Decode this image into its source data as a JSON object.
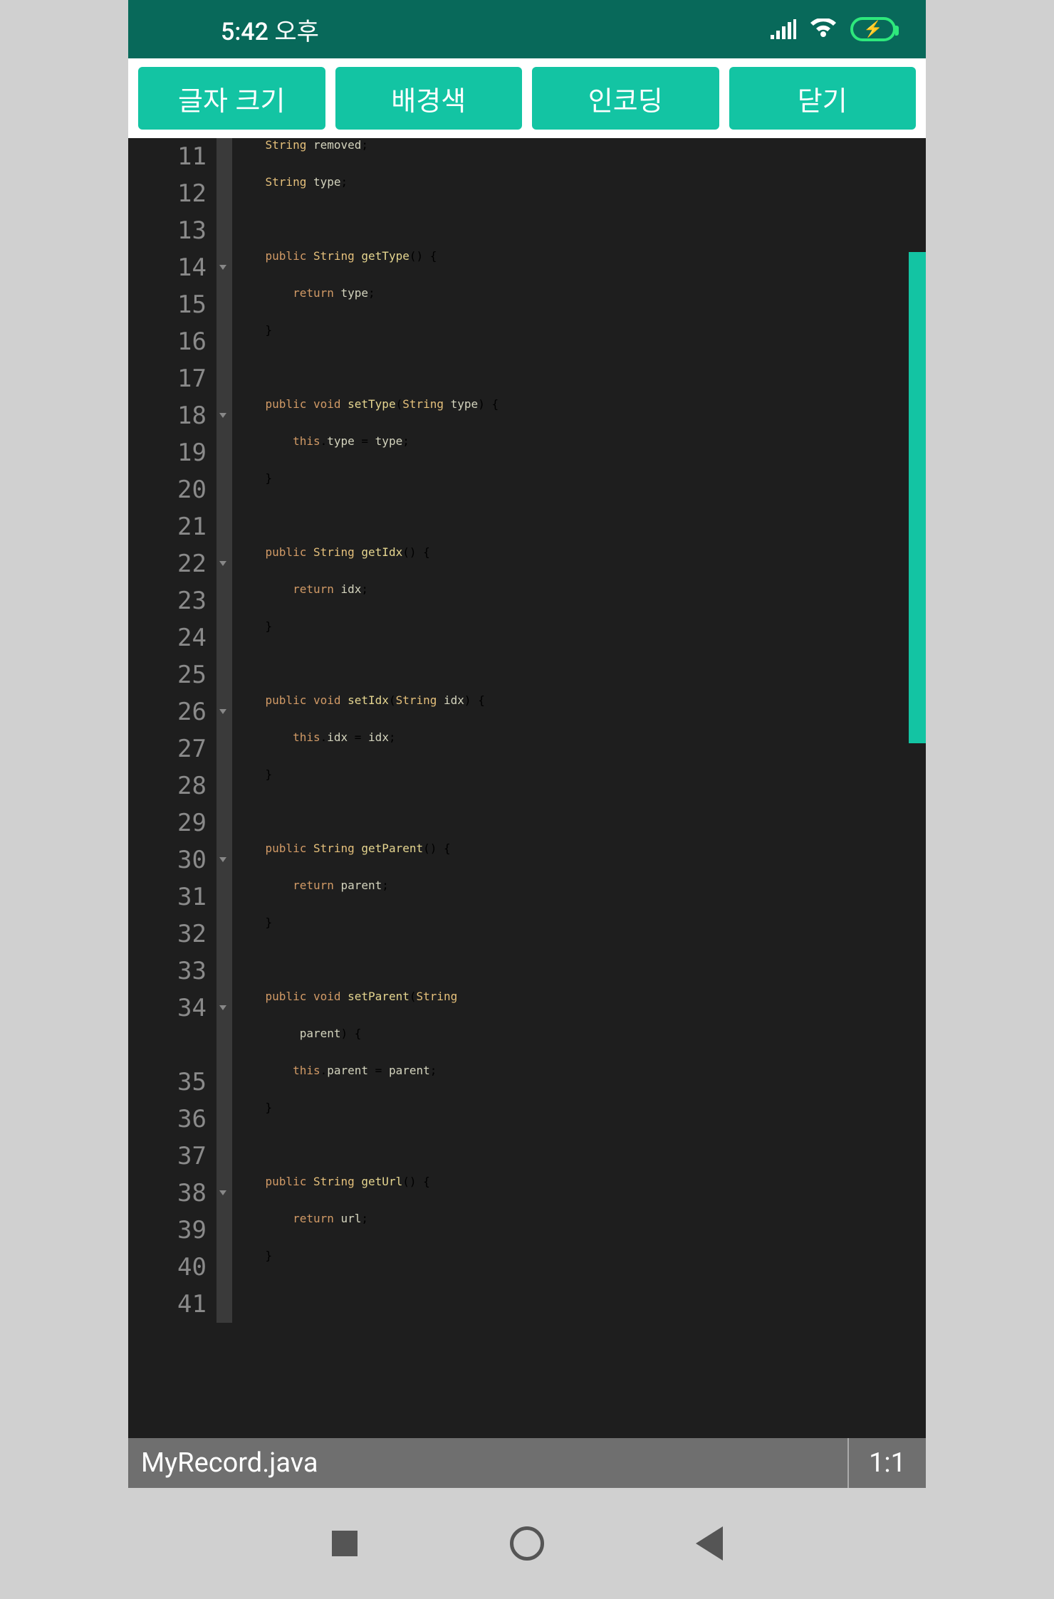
{
  "status": {
    "time": "5:42 오후"
  },
  "toolbar": {
    "font_size": "글자 크기",
    "bg_color": "배경색",
    "encoding": "인코딩",
    "close": "닫기"
  },
  "lines": [
    {
      "n": "11",
      "fold": false,
      "segs": [
        {
          "t": "    "
        },
        {
          "t": "String",
          "c": "ty"
        },
        {
          "t": " "
        },
        {
          "t": "removed",
          "c": "id"
        },
        {
          "t": ";"
        }
      ]
    },
    {
      "n": "12",
      "fold": false,
      "segs": [
        {
          "t": "    "
        },
        {
          "t": "String",
          "c": "ty"
        },
        {
          "t": " "
        },
        {
          "t": "type",
          "c": "id"
        },
        {
          "t": ";"
        }
      ]
    },
    {
      "n": "13",
      "fold": false,
      "segs": [
        {
          "t": ""
        }
      ]
    },
    {
      "n": "14",
      "fold": true,
      "segs": [
        {
          "t": "    "
        },
        {
          "t": "public",
          "c": "kw"
        },
        {
          "t": " "
        },
        {
          "t": "String",
          "c": "ty"
        },
        {
          "t": " "
        },
        {
          "t": "getType",
          "c": "fn"
        },
        {
          "t": "() {"
        }
      ]
    },
    {
      "n": "15",
      "fold": false,
      "segs": [
        {
          "t": "        "
        },
        {
          "t": "return",
          "c": "kw"
        },
        {
          "t": " "
        },
        {
          "t": "type",
          "c": "id"
        },
        {
          "t": ";"
        }
      ]
    },
    {
      "n": "16",
      "fold": false,
      "segs": [
        {
          "t": "    }"
        }
      ]
    },
    {
      "n": "17",
      "fold": false,
      "segs": [
        {
          "t": ""
        }
      ]
    },
    {
      "n": "18",
      "fold": true,
      "segs": [
        {
          "t": "    "
        },
        {
          "t": "public",
          "c": "kw"
        },
        {
          "t": " "
        },
        {
          "t": "void",
          "c": "kw"
        },
        {
          "t": " "
        },
        {
          "t": "setType",
          "c": "fn"
        },
        {
          "t": "("
        },
        {
          "t": "String",
          "c": "ty"
        },
        {
          "t": " "
        },
        {
          "t": "type",
          "c": "id"
        },
        {
          "t": ") {"
        }
      ]
    },
    {
      "n": "19",
      "fold": false,
      "segs": [
        {
          "t": "        "
        },
        {
          "t": "this",
          "c": "th"
        },
        {
          "t": "."
        },
        {
          "t": "type",
          "c": "id"
        },
        {
          "t": " = "
        },
        {
          "t": "type",
          "c": "id"
        },
        {
          "t": ";"
        }
      ]
    },
    {
      "n": "20",
      "fold": false,
      "segs": [
        {
          "t": "    }"
        }
      ]
    },
    {
      "n": "21",
      "fold": false,
      "segs": [
        {
          "t": ""
        }
      ]
    },
    {
      "n": "22",
      "fold": true,
      "segs": [
        {
          "t": "    "
        },
        {
          "t": "public",
          "c": "kw"
        },
        {
          "t": " "
        },
        {
          "t": "String",
          "c": "ty"
        },
        {
          "t": " "
        },
        {
          "t": "getIdx",
          "c": "fn"
        },
        {
          "t": "() {"
        }
      ]
    },
    {
      "n": "23",
      "fold": false,
      "segs": [
        {
          "t": "        "
        },
        {
          "t": "return",
          "c": "kw"
        },
        {
          "t": " "
        },
        {
          "t": "idx",
          "c": "id"
        },
        {
          "t": ";"
        }
      ]
    },
    {
      "n": "24",
      "fold": false,
      "segs": [
        {
          "t": "    }"
        }
      ]
    },
    {
      "n": "25",
      "fold": false,
      "segs": [
        {
          "t": ""
        }
      ]
    },
    {
      "n": "26",
      "fold": true,
      "segs": [
        {
          "t": "    "
        },
        {
          "t": "public",
          "c": "kw"
        },
        {
          "t": " "
        },
        {
          "t": "void",
          "c": "kw"
        },
        {
          "t": " "
        },
        {
          "t": "setIdx",
          "c": "fn"
        },
        {
          "t": "("
        },
        {
          "t": "String",
          "c": "ty"
        },
        {
          "t": " "
        },
        {
          "t": "idx",
          "c": "id"
        },
        {
          "t": ") {"
        }
      ]
    },
    {
      "n": "27",
      "fold": false,
      "segs": [
        {
          "t": "        "
        },
        {
          "t": "this",
          "c": "th"
        },
        {
          "t": "."
        },
        {
          "t": "idx",
          "c": "id"
        },
        {
          "t": " = "
        },
        {
          "t": "idx",
          "c": "id"
        },
        {
          "t": ";"
        }
      ]
    },
    {
      "n": "28",
      "fold": false,
      "segs": [
        {
          "t": "    }"
        }
      ]
    },
    {
      "n": "29",
      "fold": false,
      "segs": [
        {
          "t": ""
        }
      ]
    },
    {
      "n": "30",
      "fold": true,
      "segs": [
        {
          "t": "    "
        },
        {
          "t": "public",
          "c": "kw"
        },
        {
          "t": " "
        },
        {
          "t": "String",
          "c": "ty"
        },
        {
          "t": " "
        },
        {
          "t": "getParent",
          "c": "fn"
        },
        {
          "t": "() {"
        }
      ]
    },
    {
      "n": "31",
      "fold": false,
      "segs": [
        {
          "t": "        "
        },
        {
          "t": "return",
          "c": "kw"
        },
        {
          "t": " "
        },
        {
          "t": "parent",
          "c": "id"
        },
        {
          "t": ";"
        }
      ]
    },
    {
      "n": "32",
      "fold": false,
      "segs": [
        {
          "t": "    }"
        }
      ]
    },
    {
      "n": "33",
      "fold": false,
      "segs": [
        {
          "t": ""
        }
      ]
    },
    {
      "n": "34",
      "fold": true,
      "segs": [
        {
          "t": "    "
        },
        {
          "t": "public",
          "c": "kw"
        },
        {
          "t": " "
        },
        {
          "t": "void",
          "c": "kw"
        },
        {
          "t": " "
        },
        {
          "t": "setParent",
          "c": "fn"
        },
        {
          "t": "("
        },
        {
          "t": "String",
          "c": "ty"
        }
      ]
    },
    {
      "n": "",
      "fold": false,
      "segs": [
        {
          "t": "         "
        },
        {
          "t": "parent",
          "c": "id"
        },
        {
          "t": ") {"
        }
      ]
    },
    {
      "n": "35",
      "fold": false,
      "segs": [
        {
          "t": "        "
        },
        {
          "t": "this",
          "c": "th"
        },
        {
          "t": "."
        },
        {
          "t": "parent",
          "c": "id"
        },
        {
          "t": " = "
        },
        {
          "t": "parent",
          "c": "id"
        },
        {
          "t": ";"
        }
      ]
    },
    {
      "n": "36",
      "fold": false,
      "segs": [
        {
          "t": "    }"
        }
      ]
    },
    {
      "n": "37",
      "fold": false,
      "segs": [
        {
          "t": ""
        }
      ]
    },
    {
      "n": "38",
      "fold": true,
      "segs": [
        {
          "t": "    "
        },
        {
          "t": "public",
          "c": "kw"
        },
        {
          "t": " "
        },
        {
          "t": "String",
          "c": "ty"
        },
        {
          "t": " "
        },
        {
          "t": "getUrl",
          "c": "fn"
        },
        {
          "t": "() {"
        }
      ]
    },
    {
      "n": "39",
      "fold": false,
      "segs": [
        {
          "t": "        "
        },
        {
          "t": "return",
          "c": "kw"
        },
        {
          "t": " "
        },
        {
          "t": "url",
          "c": "id"
        },
        {
          "t": ";"
        }
      ]
    },
    {
      "n": "40",
      "fold": false,
      "segs": [
        {
          "t": "    }"
        }
      ]
    },
    {
      "n": "41",
      "fold": false,
      "segs": [
        {
          "t": ""
        }
      ]
    }
  ],
  "footer": {
    "filename": "MyRecord.java",
    "cursor": "1:1"
  }
}
